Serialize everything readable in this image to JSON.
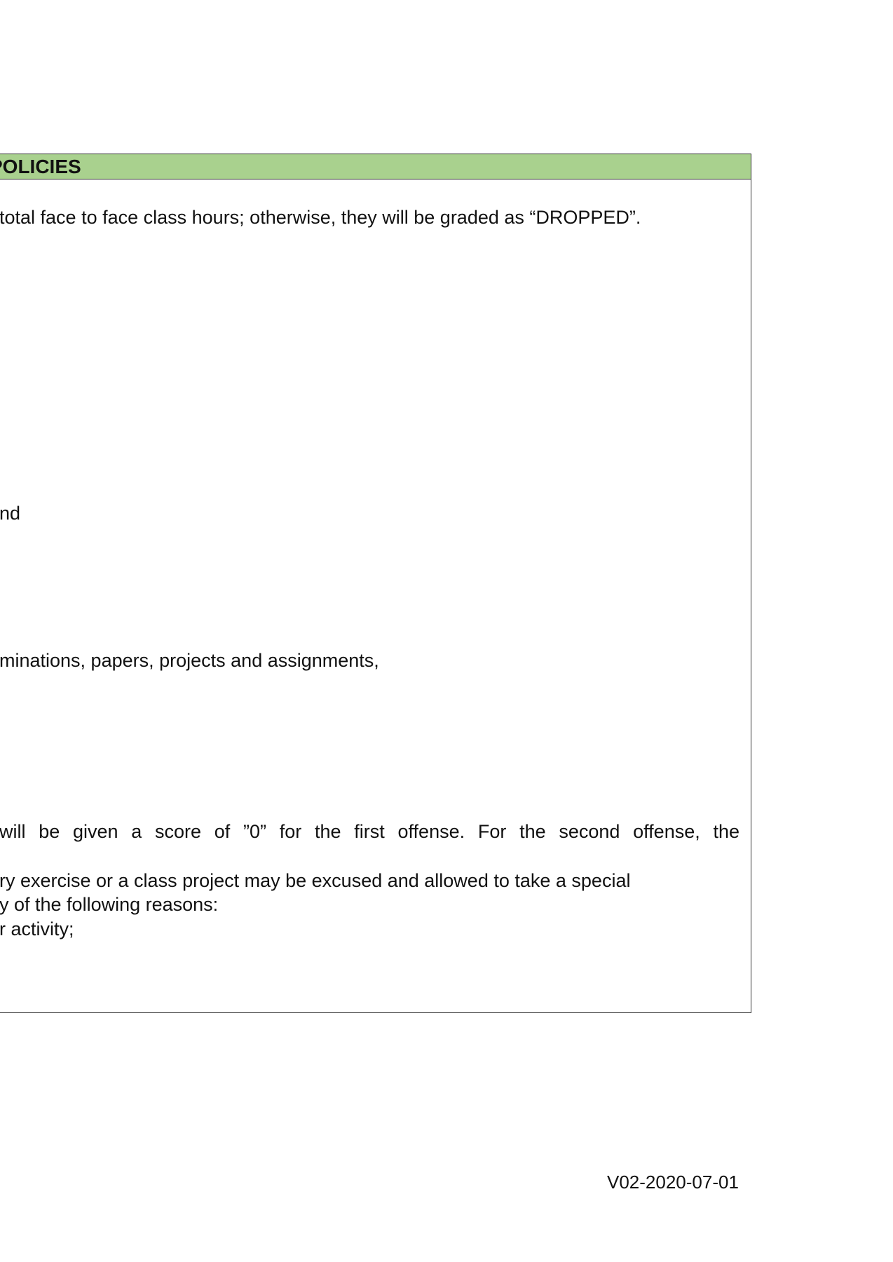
{
  "section": {
    "title": "POLICIES"
  },
  "lines": {
    "attendance": " total face to face class hours; otherwise, they will be graded as “DROPPED”.",
    "fragment_nd": "nd",
    "examinations": "minations, papers, projects and assignments,",
    "cheating": " will be given a score of ”0” for the first offense. For the second offense, the",
    "excused_1": "ry exercise or a class project may be excused and allowed to take a special",
    "excused_2": "y of the following reasons:",
    "excused_3": "r activity;"
  },
  "footer": {
    "version": "V02-2020-07-01"
  }
}
